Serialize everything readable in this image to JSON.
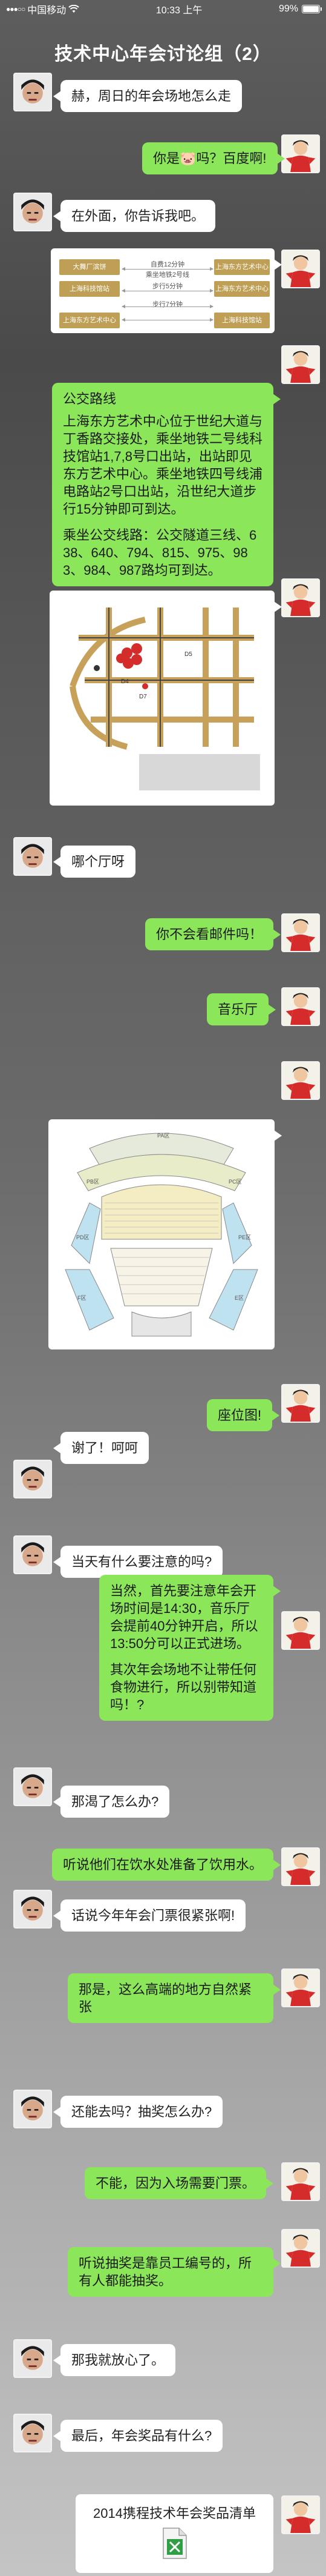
{
  "status_bar": {
    "carrier": "中国移动",
    "time": "10:33 上午",
    "battery": "99%",
    "battery_level": 0.99
  },
  "header": {
    "title": "技术中心年会讨论组（2）"
  },
  "messages": {
    "m1": "赫，周日的年会场地怎么走",
    "m2": "你是🐷吗？百度啊!",
    "m3": "在外面，你告诉我吧。",
    "route_table": {
      "rows": [
        {
          "left": "大舞厂滨饼",
          "mid": "自费12分钟",
          "mid2": "乘坐地铁2号线",
          "right": "上海东方艺术中心"
        },
        {
          "left": "上海科技馆站",
          "mid": "步行5分钟",
          "right": "上海东方艺术中心"
        },
        {
          "left": "",
          "mid": "步行7分钟",
          "right": ""
        },
        {
          "left": "上海东方艺术中心",
          "mid": "",
          "right": "上海科技馆站"
        }
      ]
    },
    "m5": {
      "p1": "公交路线",
      "p2": "上海东方艺术中心位于世纪大道与丁香路交接处，乘坐地铁二号线科技馆站1,7,8号口出站，出站即见东方艺术中心。乘坐地铁四号线浦电路站2号口出站，沿世纪大道步行15分钟即可到达。",
      "p3": "乘坐公交线路：公交隧道三线、638、640、794、815、975、983、984、987路均可到达。"
    },
    "m7": "哪个厅呀",
    "m8": "你不会看邮件吗！",
    "m9": "音乐厅",
    "m11": "座位图!",
    "m12": "谢了！呵呵",
    "m13": "当天有什么要注意的吗?",
    "m14": {
      "p1": "当然，首先要注意年会开场时间是14:30，音乐厅会提前40分钟开启，所以13:50分可以正式进场。",
      "p2": "其次年会场地不让带任何食物进行，所以别带知道吗！?"
    },
    "m15": "那渴了怎么办?",
    "m16": "听说他们在饮水处准备了饮用水。",
    "m17": "话说今年年会门票很紧张啊!",
    "m18": "那是，这么高端的地方自然紧张",
    "m19": "还能去吗？抽奖怎么办?",
    "m20": "不能，因为入场需要门票。",
    "m21": "听说抽奖是靠员工编号的，所有人都能抽奖。",
    "m22": "那我就放心了。",
    "m23": "最后，年会奖品有什么?",
    "m24": {
      "title": "2014携程技术年会奖品清单"
    }
  },
  "map": {
    "labels": [
      "D4",
      "D5",
      "D7"
    ]
  },
  "seat_chart": {
    "labels": [
      "PA区",
      "PB区",
      "PC区",
      "PD区",
      "PE区",
      "F区",
      "E区"
    ]
  },
  "colors": {
    "green_bubble": "#8ce65a",
    "white_bubble": "#ffffff",
    "route_gold": "#bf9f55"
  },
  "icons": [
    "signal-dots-icon",
    "wifi-icon",
    "battery-icon",
    "excel-file-icon"
  ]
}
